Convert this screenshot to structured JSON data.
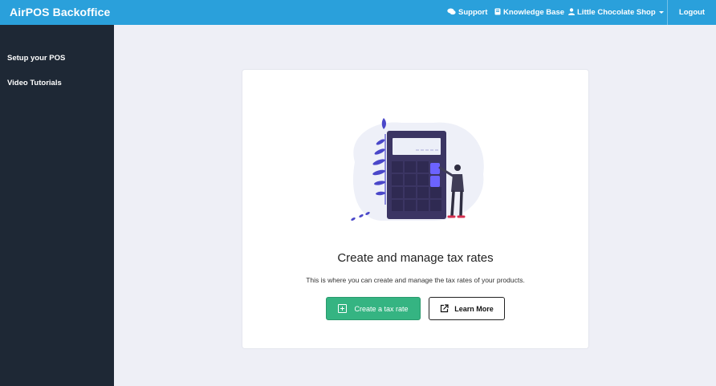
{
  "header": {
    "brand": "AirPOS Backoffice",
    "support": "Support",
    "knowledge_base": "Knowledge Base",
    "shop": "Little Chocolate Shop",
    "logout": "Logout"
  },
  "sidebar": {
    "items": [
      {
        "label": "Setup your POS"
      },
      {
        "label": "Video Tutorials"
      }
    ]
  },
  "main": {
    "title": "Create and manage tax rates",
    "description": "This is where you can create and manage the tax rates of your products.",
    "primary_button": "Create a tax rate",
    "secondary_button": "Learn More"
  },
  "colors": {
    "topbar": "#2aa0db",
    "sidebar": "#1e2835",
    "primary": "#35b482",
    "calculator": "#3b3563",
    "accent": "#6c63ff"
  },
  "icons": {
    "support": "comments-icon",
    "knowledge_base": "book-icon",
    "shop": "user-icon",
    "create": "plus-square-icon",
    "learn_more": "external-link-icon"
  }
}
